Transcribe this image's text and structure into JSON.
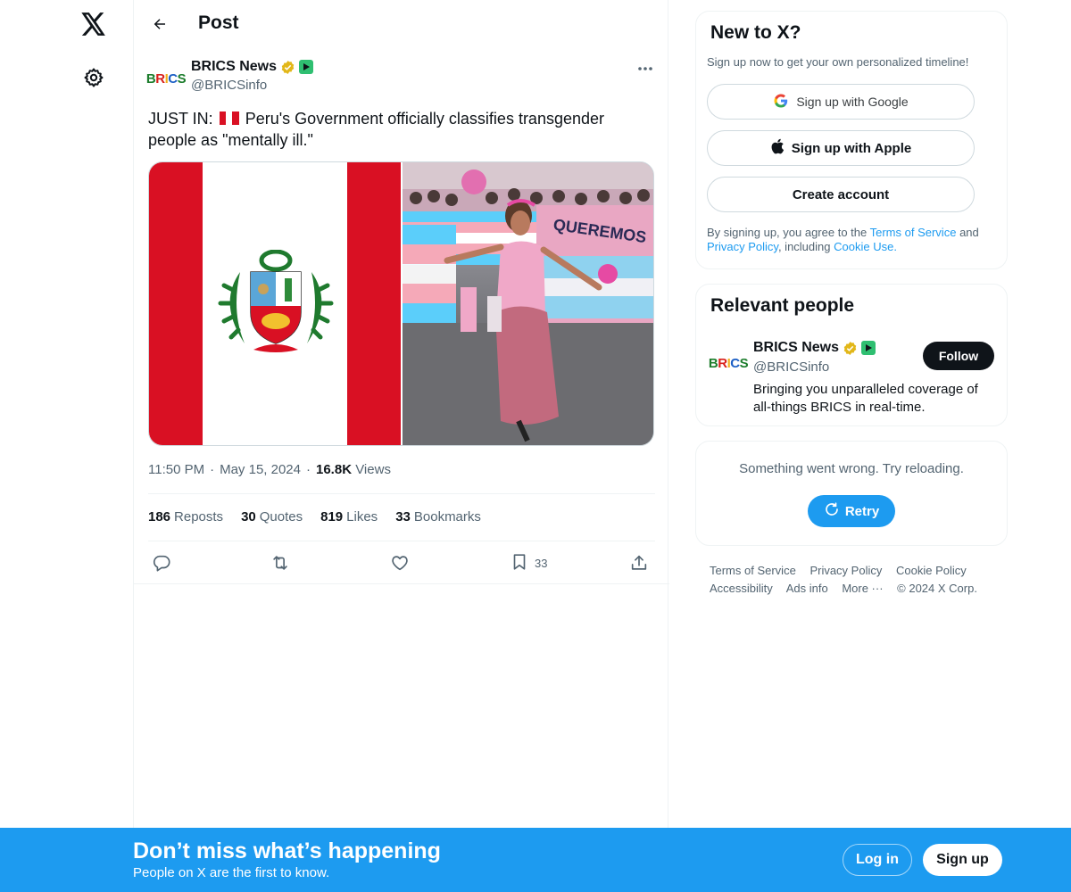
{
  "header": {
    "title": "Post"
  },
  "post": {
    "author_name": "BRICS News",
    "author_handle": "@BRICSinfo",
    "avatar_text": "BRICS",
    "text_prefix": "JUST IN:",
    "text_body": "Peru's Government officially classifies transgender people as \"mentally ill.\"",
    "time": "11:50 PM",
    "date": "May 15, 2024",
    "views_count": "16.8K",
    "views_label": "Views",
    "stats": {
      "reposts_count": "186",
      "reposts_label": "Reposts",
      "quotes_count": "30",
      "quotes_label": "Quotes",
      "likes_count": "819",
      "likes_label": "Likes",
      "bookmarks_count": "33",
      "bookmarks_label": "Bookmarks"
    },
    "bookmark_action_count": "33"
  },
  "signup_card": {
    "title": "New to X?",
    "subtitle": "Sign up now to get your own personalized timeline!",
    "google_label": "Sign up with Google",
    "apple_label": "Sign up with Apple",
    "create_label": "Create account",
    "terms_prefix": "By signing up, you agree to the",
    "terms_link": "Terms of Service",
    "terms_and": "and",
    "privacy_link": "Privacy Policy",
    "terms_including": ", including",
    "cookie_link": "Cookie Use."
  },
  "relevant_people": {
    "title": "Relevant people",
    "name": "BRICS News",
    "handle": "@BRICSinfo",
    "bio": "Bringing you unparalleled coverage of all-things BRICS in real-time.",
    "follow_label": "Follow"
  },
  "error_card": {
    "message": "Something went wrong. Try reloading.",
    "retry_label": "Retry"
  },
  "footer": {
    "terms": "Terms of Service",
    "privacy": "Privacy Policy",
    "cookie": "Cookie Policy",
    "accessibility": "Accessibility",
    "ads": "Ads info",
    "more": "More ···",
    "copyright": "© 2024 X Corp."
  },
  "banner": {
    "title": "Don’t miss what’s happening",
    "subtitle": "People on X are the first to know.",
    "login_label": "Log in",
    "signup_label": "Sign up"
  },
  "colors": {
    "accent": "#1d9bf0",
    "peru_red": "#d91023",
    "verified_gold": "#e2b719"
  },
  "icons": [
    "x-logo-icon",
    "gear-icon",
    "back-arrow-icon",
    "more-icon",
    "verified-icon",
    "reply-icon",
    "repost-icon",
    "like-icon",
    "bookmark-icon",
    "share-icon",
    "google-icon",
    "apple-icon",
    "retry-icon"
  ]
}
